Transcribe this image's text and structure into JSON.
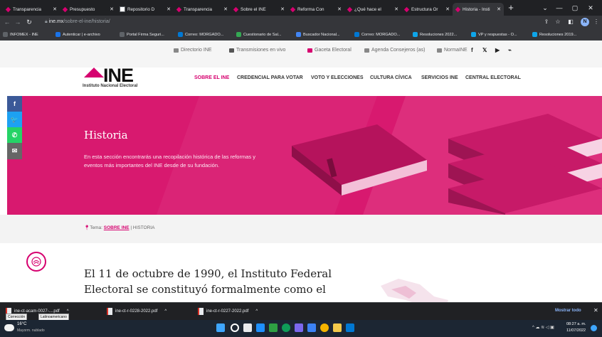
{
  "tabs": [
    {
      "label": "Transparencia",
      "fav": "ine"
    },
    {
      "label": "Presupuesto",
      "fav": "ine"
    },
    {
      "label": "Repositorio D",
      "fav": "doc"
    },
    {
      "label": "Transparencia",
      "fav": "ine"
    },
    {
      "label": "Sobre el INE",
      "fav": "ine"
    },
    {
      "label": "Reforma Con",
      "fav": "ine"
    },
    {
      "label": "¿Qué hace el",
      "fav": "ine"
    },
    {
      "label": "Estructura Or",
      "fav": "ine"
    },
    {
      "label": "Historia - Insti",
      "fav": "ine"
    }
  ],
  "browser": {
    "url_host": "ine.mx",
    "url_path": "/sobre-el-ine/historia/",
    "profile_initial": "N"
  },
  "bookmarks": [
    {
      "label": "INFOMEX - INE",
      "color": "#5f6368"
    },
    {
      "label": "Autenticar | e-archivo",
      "color": "#1a73e8"
    },
    {
      "label": "Portal Firma Seguri...",
      "color": "#5f6368"
    },
    {
      "label": "Correo: MORGADO...",
      "color": "#0078d4"
    },
    {
      "label": "Cuestionario de Sal...",
      "color": "#34a853"
    },
    {
      "label": "Buscador Nacional...",
      "color": "#4285f4"
    },
    {
      "label": "Correo: MORGADO...",
      "color": "#0078d4"
    },
    {
      "label": "Resoluciones 2022...",
      "color": "#0ea5e9"
    },
    {
      "label": "VP y respuestas - O...",
      "color": "#0ea5e9"
    },
    {
      "label": "Resoluciones 2019...",
      "color": "#0ea5e9"
    }
  ],
  "topnav": [
    {
      "label": "Directorio INE",
      "color": "#888"
    },
    {
      "label": "Transmisiones en vivo",
      "color": "#555"
    },
    {
      "label": "Gaceta Electoral",
      "color": "#d6006f"
    },
    {
      "label": "Agenda Consejeros (as)",
      "color": "#888"
    },
    {
      "label": "NormaINE",
      "color": "#888"
    }
  ],
  "social": [
    "f",
    "𝕏",
    "▶",
    "⌁"
  ],
  "logo": {
    "text": "INE",
    "subtitle": "Instituto Nacional Electoral"
  },
  "menu": [
    {
      "label": "SOBRE EL INE",
      "active": true
    },
    {
      "label": "CREDENCIAL PARA VOTAR",
      "active": false
    },
    {
      "label": "VOTO Y ELECCIONES",
      "active": false
    },
    {
      "label": "CULTURA CÍVICA",
      "active": false
    },
    {
      "label": "SERVICIOS INE",
      "active": false
    },
    {
      "label": "CENTRAL ELECTORAL",
      "active": false
    }
  ],
  "hero": {
    "title": "Historia",
    "description": "En esta sección encontrarás una recopilación histórica de las reformas y eventos más importantes del INE desde de su fundación.",
    "bg": "#d8196f"
  },
  "share": [
    {
      "label": "f",
      "color": "#3b5998",
      "name": "facebook-share-icon"
    },
    {
      "label": "🐦",
      "color": "#1da1f2",
      "name": "twitter-share-icon"
    },
    {
      "label": "✆",
      "color": "#25d366",
      "name": "whatsapp-share-icon"
    },
    {
      "label": "✉",
      "color": "#666666",
      "name": "email-share-icon"
    }
  ],
  "breadcrumb": {
    "prefix": "Tema:",
    "link": "SOBRE INE",
    "current": "| HISTORIA"
  },
  "content": {
    "paragraph": "El 11 de octubre de 1990, el Instituto Federal Electoral se constituyó formalmente como el"
  },
  "downloads": [
    {
      "label": "ine-ct-acam-0027-....pdf"
    },
    {
      "label": "ine-ct-r-0228-2022.pdf"
    },
    {
      "label": "ine-ct-r-0227-2022.pdf"
    }
  ],
  "download_bar": {
    "show_all": "Mostrar todo"
  },
  "tooltips": [
    {
      "label": "Corrección"
    },
    {
      "label": "Latinoamericano"
    }
  ],
  "taskbar": {
    "weather_temp": "16°C",
    "weather_desc": "Mayorm. nublado",
    "time": "08:27 a. m.",
    "date": "11/07/2022"
  }
}
